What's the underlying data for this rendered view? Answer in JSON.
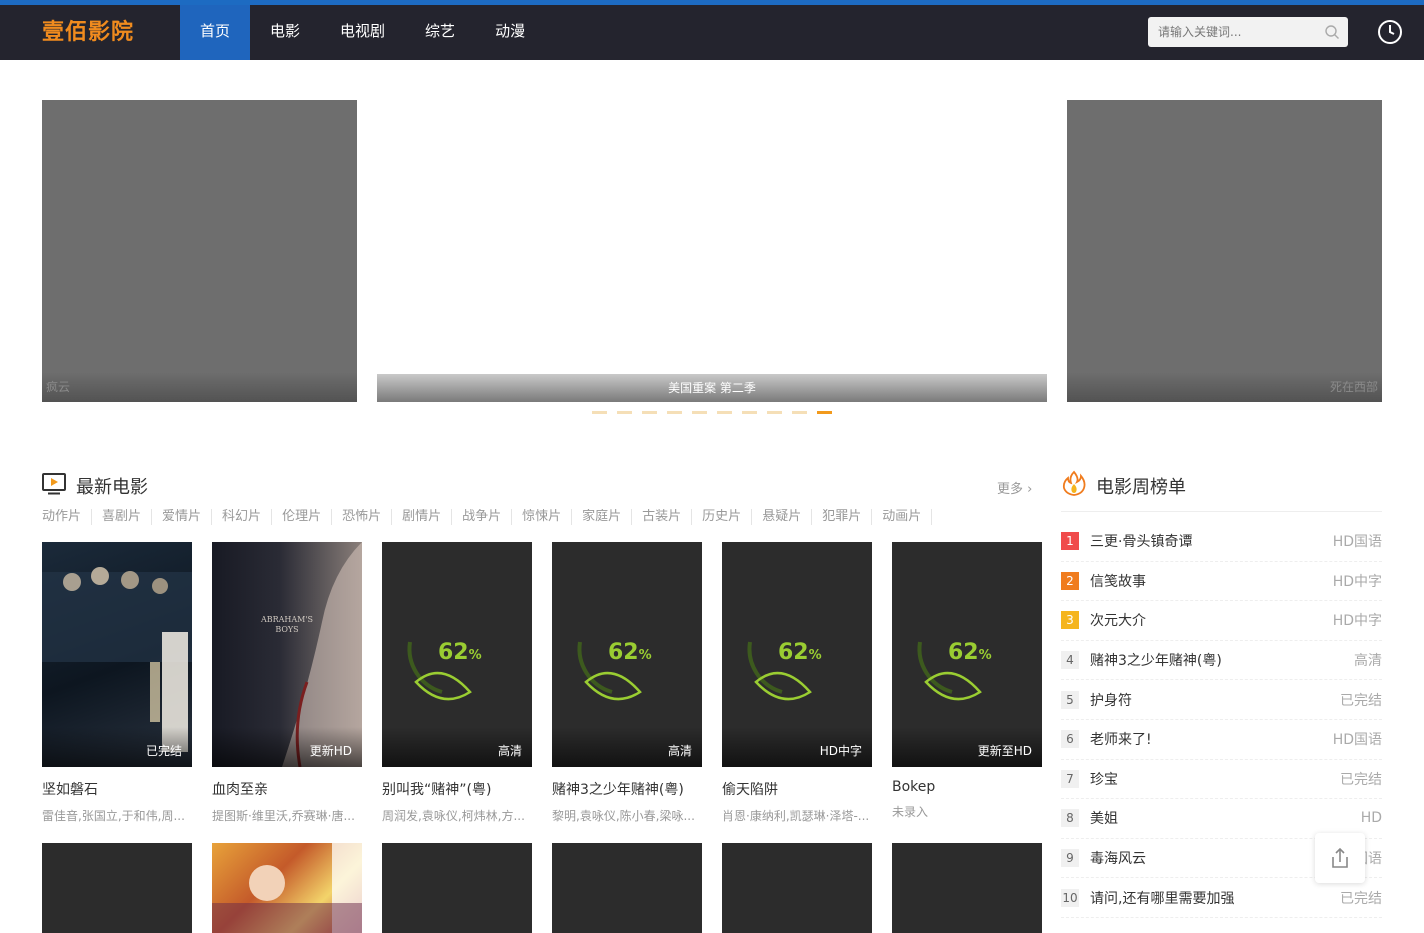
{
  "header": {
    "logo": "壹佰影院",
    "nav": [
      "首页",
      "电影",
      "电视剧",
      "综艺",
      "动漫"
    ],
    "search_placeholder": "请输入关键词..."
  },
  "carousel": {
    "left_caption": "疯云",
    "main_caption": "美国重案 第二季",
    "right_caption": "死在西部",
    "dot_count": 10,
    "active_dot": 10
  },
  "latest": {
    "title": "最新电影",
    "more": "更多",
    "categories": [
      "动作片",
      "喜剧片",
      "爱情片",
      "科幻片",
      "伦理片",
      "恐怖片",
      "剧情片",
      "战争片",
      "惊悚片",
      "家庭片",
      "古装片",
      "历史片",
      "悬疑片",
      "犯罪片",
      "动画片"
    ],
    "movies": [
      {
        "title": "坚如磐石",
        "badge": "已完结",
        "actors": "雷佳音,张国立,于和伟,周..."
      },
      {
        "title": "血肉至亲",
        "badge": "更新HD",
        "actors": "提图斯·维里沃,乔赛琳·唐..."
      },
      {
        "title": "别叫我“赌神”(粤)",
        "badge": "高清",
        "actors": "周润发,袁咏仪,柯炜林,方..."
      },
      {
        "title": "赌神3之少年赌神(粤)",
        "badge": "高清",
        "actors": "黎明,袁咏仪,陈小春,梁咏..."
      },
      {
        "title": "偷天陷阱",
        "badge": "HD中字",
        "actors": "肖恩·康纳利,凯瑟琳·泽塔-..."
      },
      {
        "title": "Bokep",
        "badge": "更新至HD",
        "actors": "未录入"
      }
    ],
    "loading_percent": "62"
  },
  "rank": {
    "title": "电影周榜单",
    "items": [
      {
        "num": "1",
        "name": "三更·骨头镇奇谭",
        "status": "HD国语"
      },
      {
        "num": "2",
        "name": "信笺故事",
        "status": "HD中字"
      },
      {
        "num": "3",
        "name": "次元大介",
        "status": "HD中字"
      },
      {
        "num": "4",
        "name": "赌神3之少年赌神(粤)",
        "status": "高清"
      },
      {
        "num": "5",
        "name": "护身符",
        "status": "已完结"
      },
      {
        "num": "6",
        "name": "老师来了!",
        "status": "HD国语"
      },
      {
        "num": "7",
        "name": "珍宝",
        "status": "已完结"
      },
      {
        "num": "8",
        "name": "美姐",
        "status": "HD"
      },
      {
        "num": "9",
        "name": "毒海风云",
        "status": "国语"
      },
      {
        "num": "10",
        "name": "请问,还有哪里需要加强",
        "status": "已完结"
      }
    ]
  },
  "colors": {
    "accent": "#1f65bd",
    "logo": "#f08b1e",
    "header_bg": "#24242e"
  }
}
